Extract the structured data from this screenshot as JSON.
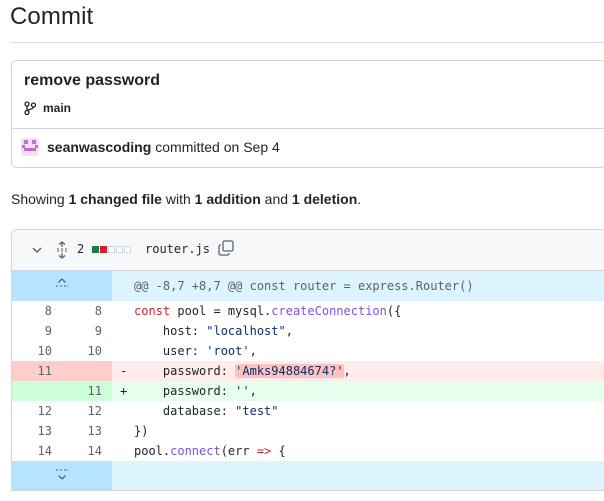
{
  "page": {
    "title": "Commit"
  },
  "commit": {
    "message": "remove password",
    "branch": "main",
    "author": "seanwascoding",
    "action": "committed on Sep 4"
  },
  "summary": {
    "prefix": "Showing",
    "changed": "1 changed file",
    "with": "with",
    "additions": "1 addition",
    "and": "and",
    "deletions": "1 deletion",
    "end": "."
  },
  "file": {
    "change_count": "2",
    "name": "router.js",
    "hunk_header": "@@ -8,7 +8,7 @@ const router = express.Router()",
    "colors": {
      "add": "#1a7f37",
      "del": "#cf222e",
      "neutral": "#d0d7de"
    }
  },
  "lines": [
    {
      "old": "8",
      "new": "8",
      "sign": "",
      "type": "ctx",
      "text": "const pool = mysql.createConnection({"
    },
    {
      "old": "9",
      "new": "9",
      "sign": "",
      "type": "ctx",
      "text": "    host: \"localhost\","
    },
    {
      "old": "10",
      "new": "10",
      "sign": "",
      "type": "ctx",
      "text": "    user: 'root',"
    },
    {
      "old": "11",
      "new": "",
      "sign": "-",
      "type": "del",
      "text": "    password: 'Amks94884674?',"
    },
    {
      "old": "",
      "new": "11",
      "sign": "+",
      "type": "add",
      "text": "    password: '',"
    },
    {
      "old": "12",
      "new": "12",
      "sign": "",
      "type": "ctx",
      "text": "    database: \"test\""
    },
    {
      "old": "13",
      "new": "13",
      "sign": "",
      "type": "ctx",
      "text": "})"
    },
    {
      "old": "14",
      "new": "14",
      "sign": "",
      "type": "ctx",
      "text": "pool.connect(err => {"
    }
  ]
}
